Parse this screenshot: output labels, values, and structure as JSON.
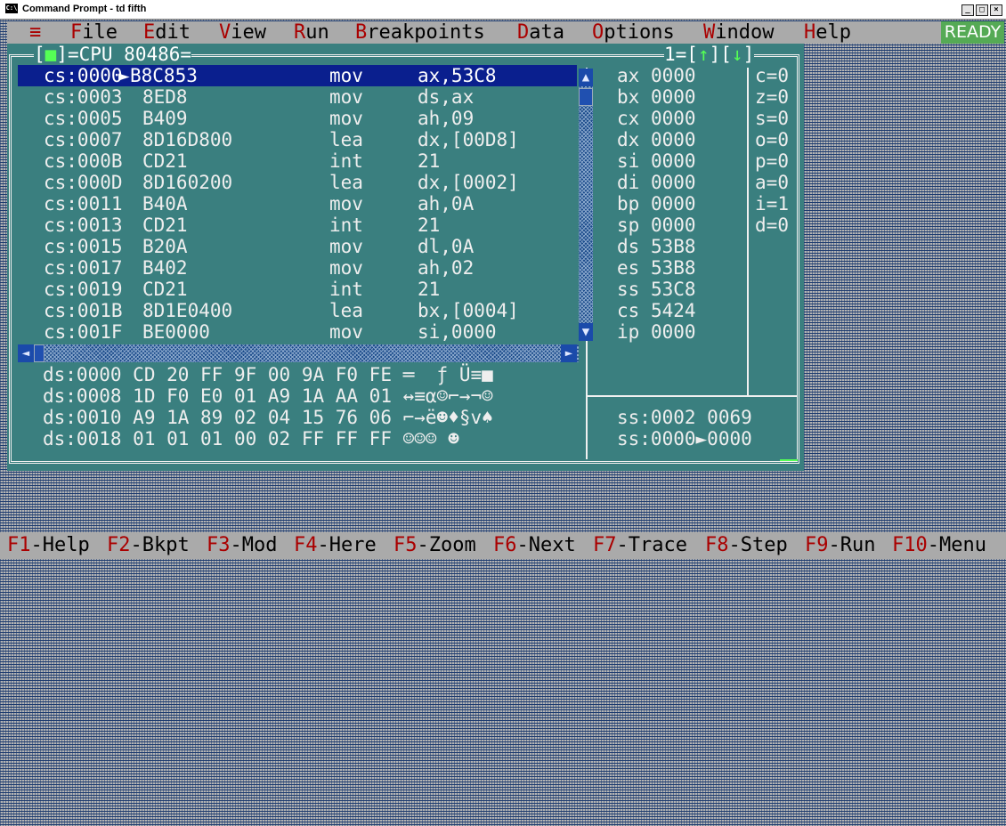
{
  "window": {
    "title": "Command Prompt - td fifth",
    "app_icon": "C:\\",
    "minimize": "_",
    "maximize": "□",
    "close": "×"
  },
  "menu": {
    "system": "≡",
    "items": [
      {
        "hot": "F",
        "rest": "ile"
      },
      {
        "hot": "E",
        "rest": "dit"
      },
      {
        "hot": "V",
        "rest": "iew"
      },
      {
        "hot": "R",
        "rest": "un"
      },
      {
        "hot": "B",
        "rest": "reakpoints"
      },
      {
        "hot": "D",
        "rest": "ata"
      },
      {
        "hot": "O",
        "rest": "ptions"
      },
      {
        "hot": "W",
        "rest": "indow"
      },
      {
        "hot": "H",
        "rest": "elp"
      }
    ],
    "status": "READY"
  },
  "cpu": {
    "title": "CPU 80486",
    "close_box": "■",
    "window_number": "1",
    "up_arrow": "↑",
    "down_arrow": "↓",
    "disasm": [
      {
        "addr": "cs:0000",
        "mark": "►",
        "bytes": "B8C853",
        "op": "mov",
        "args": "ax,53C8",
        "selected": true
      },
      {
        "addr": "cs:0003",
        "mark": " ",
        "bytes": "8ED8",
        "op": "mov",
        "args": "ds,ax"
      },
      {
        "addr": "cs:0005",
        "mark": " ",
        "bytes": "B409",
        "op": "mov",
        "args": "ah,09"
      },
      {
        "addr": "cs:0007",
        "mark": " ",
        "bytes": "8D16D800",
        "op": "lea",
        "args": "dx,[00D8]"
      },
      {
        "addr": "cs:000B",
        "mark": " ",
        "bytes": "CD21",
        "op": "int",
        "args": "21"
      },
      {
        "addr": "cs:000D",
        "mark": " ",
        "bytes": "8D160200",
        "op": "lea",
        "args": "dx,[0002]"
      },
      {
        "addr": "cs:0011",
        "mark": " ",
        "bytes": "B40A",
        "op": "mov",
        "args": "ah,0A"
      },
      {
        "addr": "cs:0013",
        "mark": " ",
        "bytes": "CD21",
        "op": "int",
        "args": "21"
      },
      {
        "addr": "cs:0015",
        "mark": " ",
        "bytes": "B20A",
        "op": "mov",
        "args": "dl,0A"
      },
      {
        "addr": "cs:0017",
        "mark": " ",
        "bytes": "B402",
        "op": "mov",
        "args": "ah,02"
      },
      {
        "addr": "cs:0019",
        "mark": " ",
        "bytes": "CD21",
        "op": "int",
        "args": "21"
      },
      {
        "addr": "cs:001B",
        "mark": " ",
        "bytes": "8D1E0400",
        "op": "lea",
        "args": "bx,[0004]"
      },
      {
        "addr": "cs:001F",
        "mark": " ",
        "bytes": "BE0000",
        "op": "mov",
        "args": "si,0000"
      }
    ],
    "registers": [
      {
        "name": "ax",
        "value": "0000"
      },
      {
        "name": "bx",
        "value": "0000"
      },
      {
        "name": "cx",
        "value": "0000"
      },
      {
        "name": "dx",
        "value": "0000"
      },
      {
        "name": "si",
        "value": "0000"
      },
      {
        "name": "di",
        "value": "0000"
      },
      {
        "name": "bp",
        "value": "0000"
      },
      {
        "name": "sp",
        "value": "0000"
      },
      {
        "name": "ds",
        "value": "53B8"
      },
      {
        "name": "es",
        "value": "53B8"
      },
      {
        "name": "ss",
        "value": "53C8"
      },
      {
        "name": "cs",
        "value": "5424"
      },
      {
        "name": "ip",
        "value": "0000"
      }
    ],
    "flags": [
      {
        "name": "c",
        "value": "0"
      },
      {
        "name": "z",
        "value": "0"
      },
      {
        "name": "s",
        "value": "0"
      },
      {
        "name": "o",
        "value": "0"
      },
      {
        "name": "p",
        "value": "0"
      },
      {
        "name": "a",
        "value": "0"
      },
      {
        "name": "i",
        "value": "1"
      },
      {
        "name": "d",
        "value": "0"
      }
    ],
    "dump": [
      {
        "addr": "ds:0000",
        "bytes": "CD 20 FF 9F 00 9A F0 FE",
        "ascii": "═  ƒ Ü≡■"
      },
      {
        "addr": "ds:0008",
        "bytes": "1D F0 E0 01 A9 1A AA 01",
        "ascii": "↔≡α☺⌐→¬☺"
      },
      {
        "addr": "ds:0010",
        "bytes": "A9 1A 89 02 04 15 76 06",
        "ascii": "⌐→ë☻♦§v♠"
      },
      {
        "addr": "ds:0018",
        "bytes": "01 01 01 00 02 FF FF FF",
        "ascii": "☺☺☺ ☻"
      }
    ],
    "stack": [
      {
        "addr": "ss:0002",
        "mark": " ",
        "value": "0069"
      },
      {
        "addr": "ss:0000",
        "mark": "►",
        "value": "0000"
      }
    ],
    "scroll": {
      "up": "▲",
      "down": "▼",
      "left": "◄",
      "right": "►"
    }
  },
  "statusbar": [
    {
      "key": "F1",
      "label": "-Help"
    },
    {
      "key": "F2",
      "label": "-Bkpt"
    },
    {
      "key": "F3",
      "label": "-Mod"
    },
    {
      "key": "F4",
      "label": "-Here"
    },
    {
      "key": "F5",
      "label": "-Zoom"
    },
    {
      "key": "F6",
      "label": "-Next"
    },
    {
      "key": "F7",
      "label": "-Trace"
    },
    {
      "key": "F8",
      "label": "-Step"
    },
    {
      "key": "F9",
      "label": "-Run"
    },
    {
      "key": "F10",
      "label": "-Menu"
    }
  ]
}
